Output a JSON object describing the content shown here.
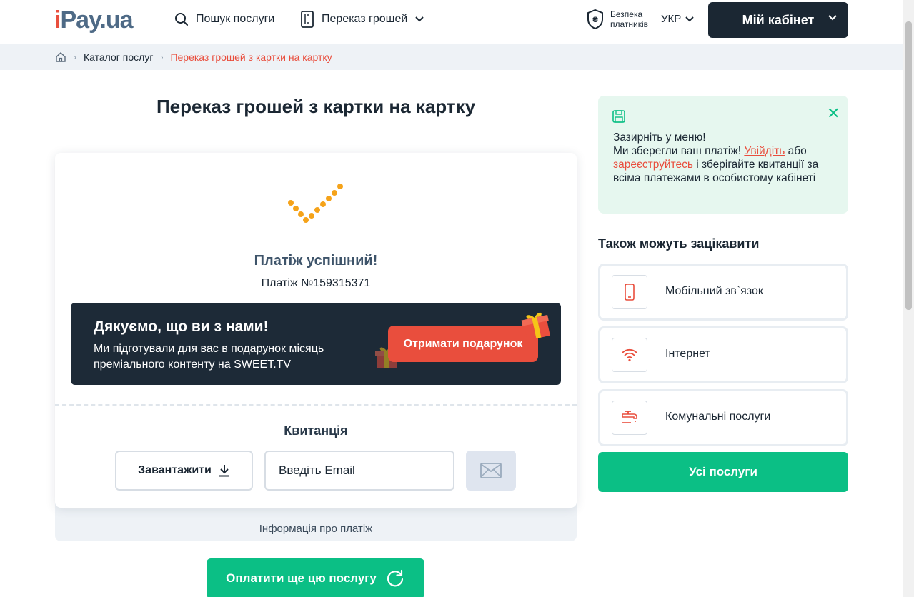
{
  "header": {
    "logo_i": "i",
    "logo_rest": "Pay.ua",
    "search_label": "Пошук послуги",
    "transfer_label": "Переказ грошей",
    "security_line1": "Безпека",
    "security_line2": "платників",
    "language": "УКР",
    "cabinet_label": "Мій кабінет"
  },
  "breadcrumb": {
    "catalog": "Каталог послуг",
    "current": "Переказ грошей з картки на картку"
  },
  "page": {
    "title": "Переказ грошей з картки на картку"
  },
  "result": {
    "title": "Платіж успішний!",
    "payment_number": "Платіж №159315371"
  },
  "promo": {
    "title": "Дякуємо, що ви з нами!",
    "text": "Ми підготували для вас в подарунок місяць преміального контенту на SWEET.TV",
    "button": "Отримати подарунок"
  },
  "receipt": {
    "title": "Квитанція",
    "download_label": "Завантажити",
    "email_placeholder": "Введіть Email"
  },
  "info_label": "Інформація про платіж",
  "pay_again_label": "Оплатити ще цю послугу",
  "notice": {
    "line1": "Зазирніть у меню!",
    "line2_start": "Ми зберегли ваш платіж! ",
    "login_link": "Увійдіть",
    "or": " або",
    "register_link": "зареєструйтесь",
    "line3_rest": " і зберігайте квитанції за всіма платежами в особистому кабінеті"
  },
  "related": {
    "title": "Також можуть зацікавити",
    "items": [
      {
        "label": "Мобільний зв`язок",
        "icon": "phone-icon"
      },
      {
        "label": "Інтернет",
        "icon": "wifi-icon"
      },
      {
        "label": "Комунальні послуги",
        "icon": "faucet-icon"
      }
    ],
    "all_label": "Усі послуги"
  },
  "colors": {
    "accent_green": "#0bbf85",
    "accent_red": "#e94e3d",
    "dark": "#1b2733",
    "check_orange": "#f5a31a"
  }
}
